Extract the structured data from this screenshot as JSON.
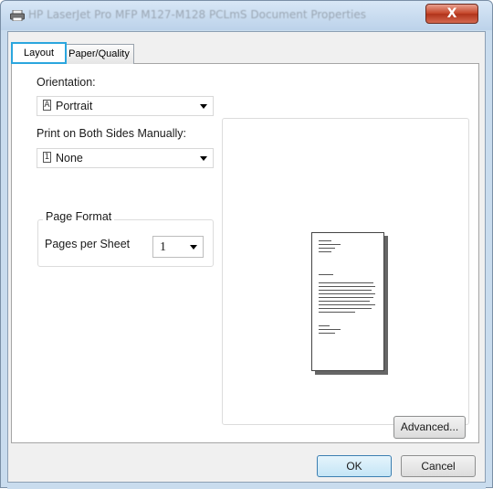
{
  "window": {
    "title": "HP LaserJet Pro MFP M127-M128 PCLmS Document Properties",
    "close_label": "X"
  },
  "tabs": [
    {
      "label": "Layout",
      "active": true
    },
    {
      "label": "Paper/Quality",
      "active": false
    }
  ],
  "layout": {
    "orientation_label": "Orientation:",
    "orientation_value": "Portrait",
    "orientation_icon": "portrait-page-icon",
    "duplex_label": "Print on Both Sides Manually:",
    "duplex_value": "None",
    "duplex_icon": "single-side-page-icon",
    "page_format_title": "Page Format",
    "pages_per_sheet_label": "Pages per Sheet",
    "pages_per_sheet_value": "1",
    "advanced_label": "Advanced..."
  },
  "footer": {
    "ok_label": "OK",
    "cancel_label": "Cancel"
  },
  "colors": {
    "active_tab_border": "#2ba6de",
    "close_button": "#c5472b",
    "frame": "#c9dcee"
  }
}
